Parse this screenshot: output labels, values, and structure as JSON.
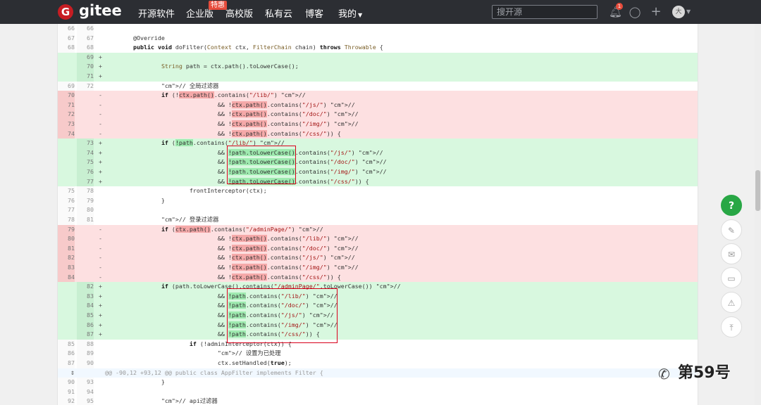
{
  "topbar": {
    "logo_letter": "G",
    "brand": "gitee",
    "nav": [
      "开源软件",
      "企业版",
      "高校版",
      "私有云",
      "博客",
      "我的"
    ],
    "enterprise_badge": "特惠",
    "search_placeholder": "搜开源",
    "notification_count": "1",
    "avatar_letter": "大"
  },
  "diff": {
    "hunk_header": "@@ -90,12 +93,12 @@ public class AppFilter implements Filter {",
    "lines": [
      {
        "t": "ctx",
        "o": "66",
        "n": "66",
        "s": "",
        "c": ""
      },
      {
        "t": "ctx",
        "o": "67",
        "n": "67",
        "s": "",
        "c": "        @Override"
      },
      {
        "t": "ctx",
        "o": "68",
        "n": "68",
        "s": "",
        "c": "        public void doFilter(Context ctx, FilterChain chain) throws Throwable {"
      },
      {
        "t": "add",
        "o": "",
        "n": "69",
        "s": "+",
        "c": ""
      },
      {
        "t": "add",
        "o": "",
        "n": "70",
        "s": "+",
        "c": "                String path = ctx.path().toLowerCase();"
      },
      {
        "t": "add",
        "o": "",
        "n": "71",
        "s": "+",
        "c": ""
      },
      {
        "t": "ctx",
        "o": "69",
        "n": "72",
        "s": "",
        "c": "                // 全局过滤器"
      },
      {
        "t": "del",
        "o": "70",
        "n": "",
        "s": "-",
        "c": "                if (!ctx.path().contains(\"/lib/\") //"
      },
      {
        "t": "del",
        "o": "71",
        "n": "",
        "s": "-",
        "c": "                                && !ctx.path().contains(\"/js/\") //"
      },
      {
        "t": "del",
        "o": "72",
        "n": "",
        "s": "-",
        "c": "                                && !ctx.path().contains(\"/doc/\") //"
      },
      {
        "t": "del",
        "o": "73",
        "n": "",
        "s": "-",
        "c": "                                && !ctx.path().contains(\"/img/\") //"
      },
      {
        "t": "del",
        "o": "74",
        "n": "",
        "s": "-",
        "c": "                                && !ctx.path().contains(\"/css/\")) {"
      },
      {
        "t": "add",
        "o": "",
        "n": "73",
        "s": "+",
        "c": "                if (!path.contains(\"/lib/\") //"
      },
      {
        "t": "add",
        "o": "",
        "n": "74",
        "s": "+",
        "c": "                                && !path.toLowerCase().contains(\"/js/\") //"
      },
      {
        "t": "add",
        "o": "",
        "n": "75",
        "s": "+",
        "c": "                                && !path.toLowerCase().contains(\"/doc/\") //"
      },
      {
        "t": "add",
        "o": "",
        "n": "76",
        "s": "+",
        "c": "                                && !path.toLowerCase().contains(\"/img/\") //"
      },
      {
        "t": "add",
        "o": "",
        "n": "77",
        "s": "+",
        "c": "                                && !path.toLowerCase().contains(\"/css/\")) {"
      },
      {
        "t": "ctx",
        "o": "75",
        "n": "78",
        "s": "",
        "c": "                        frontInterceptor(ctx);"
      },
      {
        "t": "ctx",
        "o": "76",
        "n": "79",
        "s": "",
        "c": "                }"
      },
      {
        "t": "ctx",
        "o": "77",
        "n": "80",
        "s": "",
        "c": ""
      },
      {
        "t": "ctx",
        "o": "78",
        "n": "81",
        "s": "",
        "c": "                // 登录过滤器"
      },
      {
        "t": "del",
        "o": "79",
        "n": "",
        "s": "-",
        "c": "                if (ctx.path().contains(\"/adminPage/\") //"
      },
      {
        "t": "del",
        "o": "80",
        "n": "",
        "s": "-",
        "c": "                                && !ctx.path().contains(\"/lib/\") //"
      },
      {
        "t": "del",
        "o": "81",
        "n": "",
        "s": "-",
        "c": "                                && !ctx.path().contains(\"/doc/\") //"
      },
      {
        "t": "del",
        "o": "82",
        "n": "",
        "s": "-",
        "c": "                                && !ctx.path().contains(\"/js/\") //"
      },
      {
        "t": "del",
        "o": "83",
        "n": "",
        "s": "-",
        "c": "                                && !ctx.path().contains(\"/img/\") //"
      },
      {
        "t": "del",
        "o": "84",
        "n": "",
        "s": "-",
        "c": "                                && !ctx.path().contains(\"/css/\")) {"
      },
      {
        "t": "add",
        "o": "",
        "n": "82",
        "s": "+",
        "c": "                if (path.toLowerCase().contains(\"/adminPage/\".toLowerCase()) //"
      },
      {
        "t": "add",
        "o": "",
        "n": "83",
        "s": "+",
        "c": "                                && !path.contains(\"/lib/\") //"
      },
      {
        "t": "add",
        "o": "",
        "n": "84",
        "s": "+",
        "c": "                                && !path.contains(\"/doc/\") //"
      },
      {
        "t": "add",
        "o": "",
        "n": "85",
        "s": "+",
        "c": "                                && !path.contains(\"/js/\") //"
      },
      {
        "t": "add",
        "o": "",
        "n": "86",
        "s": "+",
        "c": "                                && !path.contains(\"/img/\") //"
      },
      {
        "t": "add",
        "o": "",
        "n": "87",
        "s": "+",
        "c": "                                && !path.contains(\"/css/\")) {"
      },
      {
        "t": "ctx",
        "o": "85",
        "n": "88",
        "s": "",
        "c": "                        if (!adminInterceptor(ctx)) {"
      },
      {
        "t": "ctx",
        "o": "86",
        "n": "89",
        "s": "",
        "c": "                                // 设置为已处理"
      },
      {
        "t": "ctx",
        "o": "87",
        "n": "90",
        "s": "",
        "c": "                                ctx.setHandled(true);"
      },
      {
        "t": "hunk",
        "o": "",
        "n": "",
        "s": "",
        "c": ""
      },
      {
        "t": "ctx",
        "o": "90",
        "n": "93",
        "s": "",
        "c": "                }"
      },
      {
        "t": "ctx",
        "o": "91",
        "n": "94",
        "s": "",
        "c": ""
      },
      {
        "t": "ctx",
        "o": "92",
        "n": "95",
        "s": "",
        "c": "                // api过滤器"
      }
    ]
  },
  "side_actions": [
    "help-button",
    "edit-button",
    "mail-button",
    "comment-button",
    "report-button",
    "back-to-top-button"
  ],
  "side_glyphs": {
    "help": "?",
    "edit": "✎",
    "mail": "✉",
    "comment": "▭",
    "report": "⚠",
    "top": "⤒"
  },
  "watermark": "第59号"
}
